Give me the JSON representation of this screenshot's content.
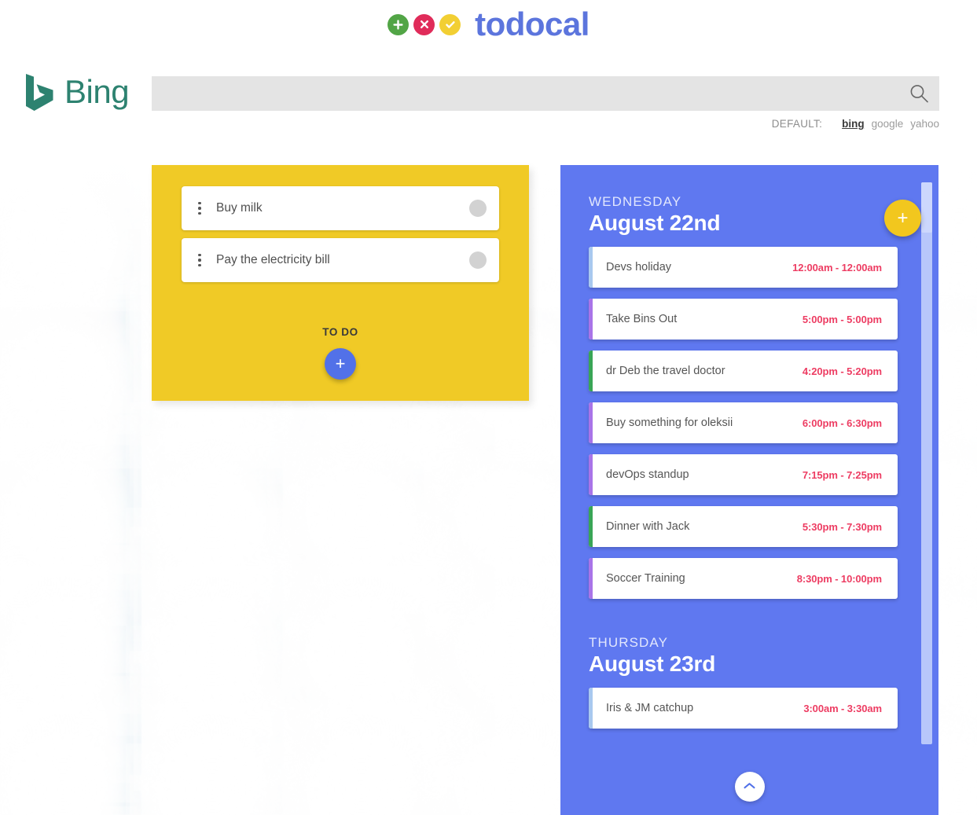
{
  "brand": {
    "name": "todocal",
    "dots": [
      {
        "icon": "plus-circle-icon",
        "color": "#52a546",
        "glyph": "+"
      },
      {
        "icon": "x-circle-icon",
        "color": "#e02c5a",
        "glyph": "✕"
      },
      {
        "icon": "check-circle-icon",
        "color": "#f2cf33",
        "glyph": "✓"
      }
    ]
  },
  "search": {
    "provider_logo": "bing-logo",
    "provider_word": "Bing",
    "value": "",
    "placeholder": "",
    "icon": "search-icon",
    "defaults_label": "DEFAULT:",
    "engines": [
      {
        "label": "bing",
        "active": true
      },
      {
        "label": "google",
        "active": false
      },
      {
        "label": "yahoo",
        "active": false
      }
    ]
  },
  "todo": {
    "caption": "TO DO",
    "add_label": "+",
    "items": [
      {
        "label": "Buy milk",
        "menu_icon": "kebab-menu-icon",
        "done": false
      },
      {
        "label": "Pay the electricity bill",
        "menu_icon": "kebab-menu-icon",
        "done": false
      }
    ]
  },
  "calendar": {
    "add_label": "+",
    "scroll_top_icon": "chevron-up-icon",
    "days": [
      {
        "weekday": "WEDNESDAY",
        "date": "August 22nd",
        "events": [
          {
            "title": "Devs holiday",
            "time": "12:00am - 12:00am",
            "color": "#a8c8ef"
          },
          {
            "title": "Take Bins Out",
            "time": "5:00pm - 5:00pm",
            "color": "#a974e8"
          },
          {
            "title": "dr Deb the travel doctor",
            "time": "4:20pm - 5:20pm",
            "color": "#39a556"
          },
          {
            "title": "Buy something for oleksii",
            "time": "6:00pm - 6:30pm",
            "color": "#a974e8"
          },
          {
            "title": "devOps standup",
            "time": "7:15pm - 7:25pm",
            "color": "#a974e8"
          },
          {
            "title": "Dinner with Jack",
            "time": "5:30pm - 7:30pm",
            "color": "#39a556"
          },
          {
            "title": "Soccer Training",
            "time": "8:30pm - 10:00pm",
            "color": "#a974e8"
          }
        ]
      },
      {
        "weekday": "THURSDAY",
        "date": "August 23rd",
        "events": [
          {
            "title": "Iris & JM catchup",
            "time": "3:00am - 3:30am",
            "color": "#a8c8ef"
          }
        ]
      }
    ]
  },
  "colors": {
    "brand_blue": "#5c75dd",
    "calendar_blue": "#5f78f0",
    "todo_yellow": "#f0ca26",
    "event_time_red": "#ed3c62",
    "bing_teal": "#2d8270"
  }
}
